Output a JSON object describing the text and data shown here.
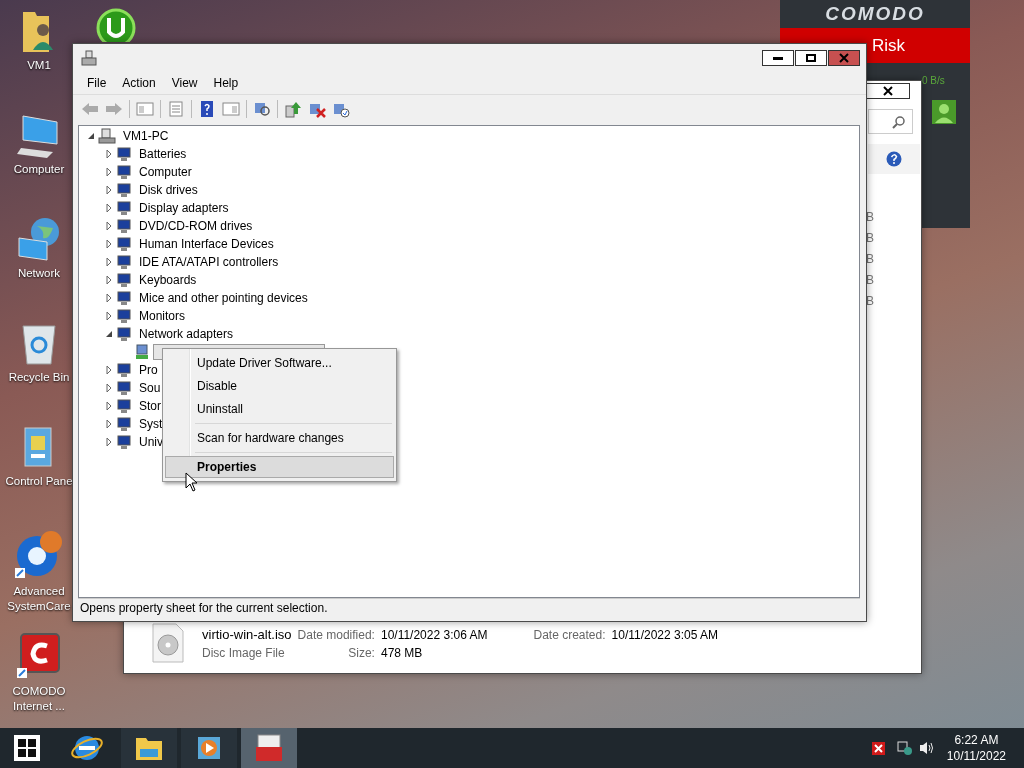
{
  "desktop_icons": [
    {
      "label": "VM1"
    },
    {
      "label": "Computer"
    },
    {
      "label": "Network"
    },
    {
      "label": "Recycle Bin"
    },
    {
      "label": "Control Pane"
    },
    {
      "label": "Advanced SystemCare"
    },
    {
      "label": "COMODO Internet ..."
    }
  ],
  "comodo_widget": {
    "title": "COMODO",
    "status": "Risk",
    "speed": "0 B/s"
  },
  "explorer_window": {
    "column_3": [
      "B",
      "B",
      "B",
      "B",
      "B"
    ],
    "details": {
      "file_name": "virtio-win-alt.iso",
      "file_type": "Disc Image File",
      "fields": [
        {
          "label": "Date modified:",
          "value": "10/11/2022 3:06 AM"
        },
        {
          "label": "Size:",
          "value": "478 MB"
        },
        {
          "label": "Date created:",
          "value": "10/11/2022 3:05 AM"
        }
      ]
    }
  },
  "device_manager": {
    "menu": [
      "File",
      "Action",
      "View",
      "Help"
    ],
    "tree": {
      "label": "VM1-PC",
      "expanded": true,
      "selected": false,
      "children": [
        {
          "label": "Batteries",
          "expanded": false,
          "selected": false
        },
        {
          "label": "Computer",
          "expanded": false,
          "selected": false
        },
        {
          "label": "Disk drives",
          "expanded": false,
          "selected": false
        },
        {
          "label": "Display adapters",
          "expanded": false,
          "selected": false
        },
        {
          "label": "DVD/CD-ROM drives",
          "expanded": false,
          "selected": false
        },
        {
          "label": "Human Interface Devices",
          "expanded": false,
          "selected": false
        },
        {
          "label": "IDE ATA/ATAPI controllers",
          "expanded": false,
          "selected": false
        },
        {
          "label": "Keyboards",
          "expanded": false,
          "selected": false
        },
        {
          "label": "Mice and other pointing devices",
          "expanded": false,
          "selected": false
        },
        {
          "label": "Monitors",
          "expanded": false,
          "selected": false
        },
        {
          "label": "Network adapters",
          "expanded": true,
          "selected": false,
          "children": [
            {
              "selected": true
            }
          ]
        },
        {
          "label": "Pro",
          "expanded": false,
          "selected": false
        },
        {
          "label": "Sou",
          "expanded": false,
          "selected": false
        },
        {
          "label": "Stor",
          "expanded": false,
          "selected": false
        },
        {
          "label": "Syst",
          "expanded": false,
          "selected": false
        },
        {
          "label": "Univ",
          "expanded": false,
          "selected": false
        }
      ]
    },
    "status_bar": "Opens property sheet for the current selection."
  },
  "context_menu": [
    [
      {
        "label": "Update Driver Software...",
        "selected": false
      },
      {
        "label": "Disable",
        "selected": false
      },
      {
        "label": "Uninstall",
        "selected": false
      }
    ],
    [
      {
        "label": "Scan for hardware changes",
        "selected": false
      }
    ],
    [
      {
        "label": "Properties",
        "selected": true
      }
    ]
  ],
  "taskbar": {
    "apps": [
      {
        "selected": false
      },
      {
        "selected": false
      },
      {
        "selected": true
      }
    ],
    "clock": {
      "time": "6:22 AM",
      "date": "10/11/2022"
    }
  }
}
